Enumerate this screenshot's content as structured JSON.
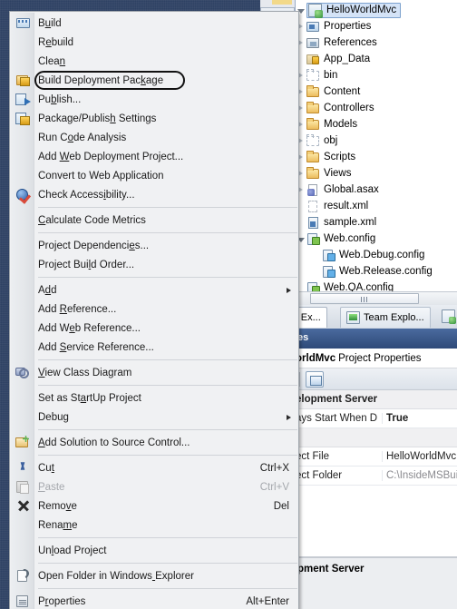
{
  "solution_explorer": {
    "tree": [
      {
        "label": "HelloWorldMvc",
        "icon": "project-icon",
        "indent": 0,
        "expander": "open",
        "selected": true
      },
      {
        "label": "Properties",
        "icon": "properties-icon",
        "indent": 1,
        "expander": "closed",
        "selected": false
      },
      {
        "label": "References",
        "icon": "references-icon",
        "indent": 1,
        "expander": "closed",
        "selected": false
      },
      {
        "label": "App_Data",
        "icon": "folder-lock-icon",
        "indent": 1,
        "expander": "none",
        "selected": false
      },
      {
        "label": "bin",
        "icon": "folder-dashed-icon",
        "indent": 1,
        "expander": "closed",
        "selected": false
      },
      {
        "label": "Content",
        "icon": "folder-icon",
        "indent": 1,
        "expander": "closed",
        "selected": false
      },
      {
        "label": "Controllers",
        "icon": "folder-icon",
        "indent": 1,
        "expander": "closed",
        "selected": false
      },
      {
        "label": "Models",
        "icon": "folder-icon",
        "indent": 1,
        "expander": "closed",
        "selected": false
      },
      {
        "label": "obj",
        "icon": "folder-dashed-icon",
        "indent": 1,
        "expander": "closed",
        "selected": false
      },
      {
        "label": "Scripts",
        "icon": "folder-icon",
        "indent": 1,
        "expander": "closed",
        "selected": false
      },
      {
        "label": "Views",
        "icon": "folder-icon",
        "indent": 1,
        "expander": "closed",
        "selected": false
      },
      {
        "label": "Global.asax",
        "icon": "asax-file-icon",
        "indent": 1,
        "expander": "closed",
        "selected": false
      },
      {
        "label": "result.xml",
        "icon": "blank-file-icon",
        "indent": 1,
        "expander": "none",
        "selected": false
      },
      {
        "label": "sample.xml",
        "icon": "xml-file-icon",
        "indent": 1,
        "expander": "none",
        "selected": false
      },
      {
        "label": "Web.config",
        "icon": "config-file-icon",
        "indent": 1,
        "expander": "open",
        "selected": false
      },
      {
        "label": "Web.Debug.config",
        "icon": "transform-config-icon",
        "indent": 2,
        "expander": "none",
        "selected": false
      },
      {
        "label": "Web.Release.config",
        "icon": "transform-config-icon",
        "indent": 2,
        "expander": "none",
        "selected": false
      },
      {
        "label": "Web.QA.config",
        "icon": "config-file-icon",
        "indent": 1,
        "expander": "none",
        "selected": false
      }
    ]
  },
  "tabs": [
    {
      "label": "tion Ex...",
      "icon": "solution-explorer-icon",
      "active": true
    },
    {
      "label": "Team Explo...",
      "icon": "team-explorer-icon",
      "active": false
    }
  ],
  "properties_panel": {
    "title": "es",
    "header_bold": "orldMvc",
    "header_normal": "Project Properties",
    "toolbar_button": "categorized-view-button",
    "rows": [
      {
        "type": "category",
        "name": "elopment Server",
        "value": ""
      },
      {
        "type": "row",
        "name": "ays Start When D",
        "value": "True",
        "bold": true
      },
      {
        "type": "category",
        "name": "",
        "value": ""
      },
      {
        "type": "row",
        "name": "ect File",
        "value": "HelloWorldMvc",
        "bold": false
      },
      {
        "type": "row",
        "name": "ect Folder",
        "value": "C:\\InsideMSBuil",
        "bold": false,
        "dim": true
      }
    ],
    "description_title": "pment Server"
  },
  "context_menu": {
    "items": [
      {
        "kind": "item",
        "label": "Build",
        "accel": "",
        "icon": "build-icon",
        "underline": 1,
        "disabled": false,
        "submenu": false,
        "circled": false
      },
      {
        "kind": "item",
        "label": "Rebuild",
        "accel": "",
        "icon": "",
        "underline": 1,
        "disabled": false,
        "submenu": false,
        "circled": false
      },
      {
        "kind": "item",
        "label": "Clean",
        "accel": "",
        "icon": "",
        "underline": 4,
        "disabled": false,
        "submenu": false,
        "circled": false
      },
      {
        "kind": "item",
        "label": "Build Deployment Package",
        "accel": "",
        "icon": "package-icon",
        "underline": 20,
        "disabled": false,
        "submenu": false,
        "circled": true
      },
      {
        "kind": "item",
        "label": "Publish...",
        "accel": "",
        "icon": "publish-icon",
        "underline": 2,
        "disabled": false,
        "submenu": false,
        "circled": false
      },
      {
        "kind": "item",
        "label": "Package/Publish Settings",
        "accel": "",
        "icon": "package-publish-settings-icon",
        "underline": 14,
        "disabled": false,
        "submenu": false,
        "circled": false
      },
      {
        "kind": "item",
        "label": "Run Code Analysis",
        "accel": "",
        "icon": "",
        "underline": 5,
        "disabled": false,
        "submenu": false,
        "circled": false
      },
      {
        "kind": "item",
        "label": "Add Web Deployment Project...",
        "accel": "",
        "icon": "",
        "underline": 4,
        "disabled": false,
        "submenu": false,
        "circled": false
      },
      {
        "kind": "item",
        "label": "Convert to Web Application",
        "accel": "",
        "icon": "",
        "underline": -1,
        "disabled": false,
        "submenu": false,
        "circled": false
      },
      {
        "kind": "item",
        "label": "Check Accessibility...",
        "accel": "",
        "icon": "accessibility-icon",
        "underline": 12,
        "disabled": false,
        "submenu": false,
        "circled": false
      },
      {
        "kind": "separator"
      },
      {
        "kind": "item",
        "label": "Calculate Code Metrics",
        "accel": "",
        "icon": "",
        "underline": 0,
        "disabled": false,
        "submenu": false,
        "circled": false
      },
      {
        "kind": "separator"
      },
      {
        "kind": "item",
        "label": "Project Dependencies...",
        "accel": "",
        "icon": "",
        "underline": 18,
        "disabled": false,
        "submenu": false,
        "circled": false
      },
      {
        "kind": "item",
        "label": "Project Build Order...",
        "accel": "",
        "icon": "",
        "underline": 11,
        "disabled": false,
        "submenu": false,
        "circled": false
      },
      {
        "kind": "separator"
      },
      {
        "kind": "item",
        "label": "Add",
        "accel": "",
        "icon": "",
        "underline": 1,
        "disabled": false,
        "submenu": true,
        "circled": false
      },
      {
        "kind": "item",
        "label": "Add Reference...",
        "accel": "",
        "icon": "",
        "underline": 4,
        "disabled": false,
        "submenu": false,
        "circled": false
      },
      {
        "kind": "item",
        "label": "Add Web Reference...",
        "accel": "",
        "icon": "",
        "underline": 5,
        "disabled": false,
        "submenu": false,
        "circled": false
      },
      {
        "kind": "item",
        "label": "Add Service Reference...",
        "accel": "",
        "icon": "",
        "underline": 4,
        "disabled": false,
        "submenu": false,
        "circled": false
      },
      {
        "kind": "separator"
      },
      {
        "kind": "item",
        "label": "View Class Diagram",
        "accel": "",
        "icon": "class-diagram-icon",
        "underline": 0,
        "disabled": false,
        "submenu": false,
        "circled": false
      },
      {
        "kind": "separator"
      },
      {
        "kind": "item",
        "label": "Set as StartUp Project",
        "accel": "",
        "icon": "",
        "underline": 9,
        "disabled": false,
        "submenu": false,
        "circled": false
      },
      {
        "kind": "item",
        "label": "Debug",
        "accel": "",
        "icon": "",
        "underline": 4,
        "disabled": false,
        "submenu": true,
        "circled": false
      },
      {
        "kind": "separator"
      },
      {
        "kind": "item",
        "label": "Add Solution to Source Control...",
        "accel": "",
        "icon": "source-control-icon",
        "underline": 0,
        "disabled": false,
        "submenu": false,
        "circled": false
      },
      {
        "kind": "separator"
      },
      {
        "kind": "item",
        "label": "Cut",
        "accel": "Ctrl+X",
        "icon": "scissors-icon",
        "underline": 2,
        "disabled": false,
        "submenu": false,
        "circled": false
      },
      {
        "kind": "item",
        "label": "Paste",
        "accel": "Ctrl+V",
        "icon": "clipboard-icon",
        "underline": 0,
        "disabled": true,
        "submenu": false,
        "circled": false
      },
      {
        "kind": "item",
        "label": "Remove",
        "accel": "Del",
        "icon": "close-x-icon",
        "underline": 4,
        "disabled": false,
        "submenu": false,
        "circled": false
      },
      {
        "kind": "item",
        "label": "Rename",
        "accel": "",
        "icon": "",
        "underline": 4,
        "disabled": false,
        "submenu": false,
        "circled": false
      },
      {
        "kind": "separator"
      },
      {
        "kind": "item",
        "label": "Unload Project",
        "accel": "",
        "icon": "",
        "underline": 2,
        "disabled": false,
        "submenu": false,
        "circled": false
      },
      {
        "kind": "separator"
      },
      {
        "kind": "item",
        "label": "Open Folder in Windows Explorer",
        "accel": "",
        "icon": "open-folder-icon",
        "underline": 22,
        "disabled": false,
        "submenu": false,
        "circled": false
      },
      {
        "kind": "separator"
      },
      {
        "kind": "item",
        "label": "Properties",
        "accel": "Alt+Enter",
        "icon": "properties-icon",
        "underline": 1,
        "disabled": false,
        "submenu": false,
        "circled": false
      }
    ]
  },
  "colors": {
    "desktop_bg": "#2e4163",
    "menu_bg": "#f0f1f3",
    "selection_blue": "#d4e3f7",
    "titlebar_blue": "#2e4a79",
    "highlight_ring": "#111111"
  }
}
